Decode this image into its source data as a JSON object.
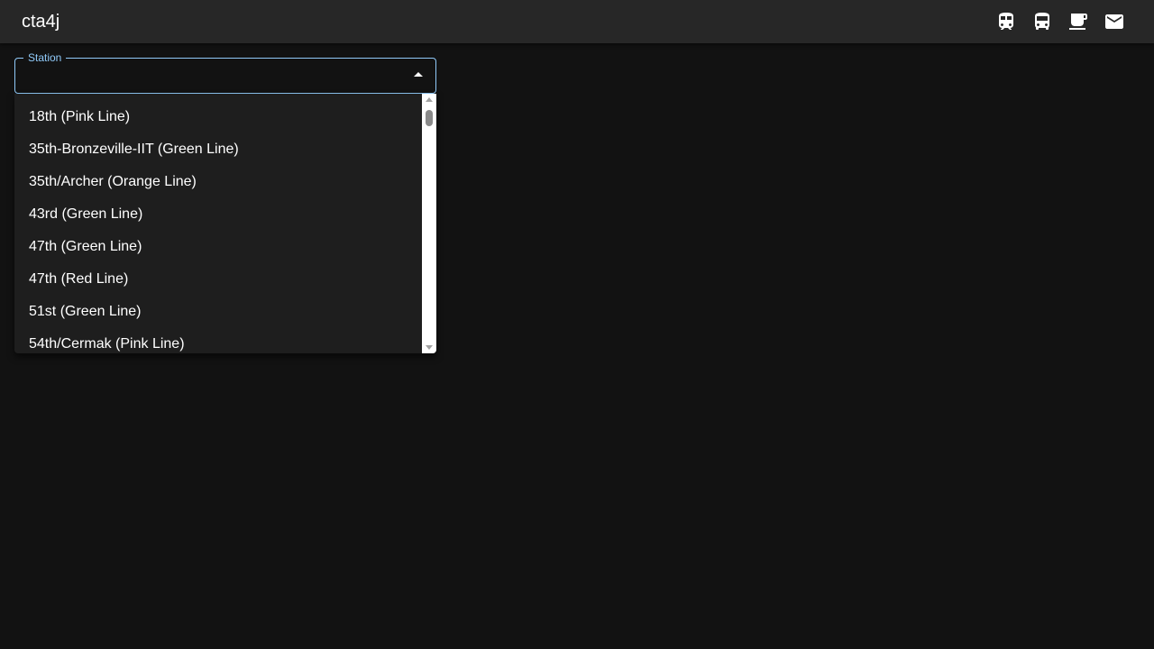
{
  "app": {
    "title": "cta4j"
  },
  "nav": {
    "icons": [
      {
        "name": "train-icon"
      },
      {
        "name": "bus-icon"
      },
      {
        "name": "coffee-icon"
      },
      {
        "name": "mail-icon"
      }
    ]
  },
  "station_select": {
    "label": "Station",
    "value": "",
    "options": [
      "18th (Pink Line)",
      "35th-Bronzeville-IIT (Green Line)",
      "35th/Archer (Orange Line)",
      "43rd (Green Line)",
      "47th (Green Line)",
      "47th (Red Line)",
      "51st (Green Line)",
      "54th/Cermak (Pink Line)"
    ]
  },
  "colors": {
    "background": "#121212",
    "appbar": "#272727",
    "accent": "#90caf9",
    "listbox": "#1e1e1e"
  }
}
